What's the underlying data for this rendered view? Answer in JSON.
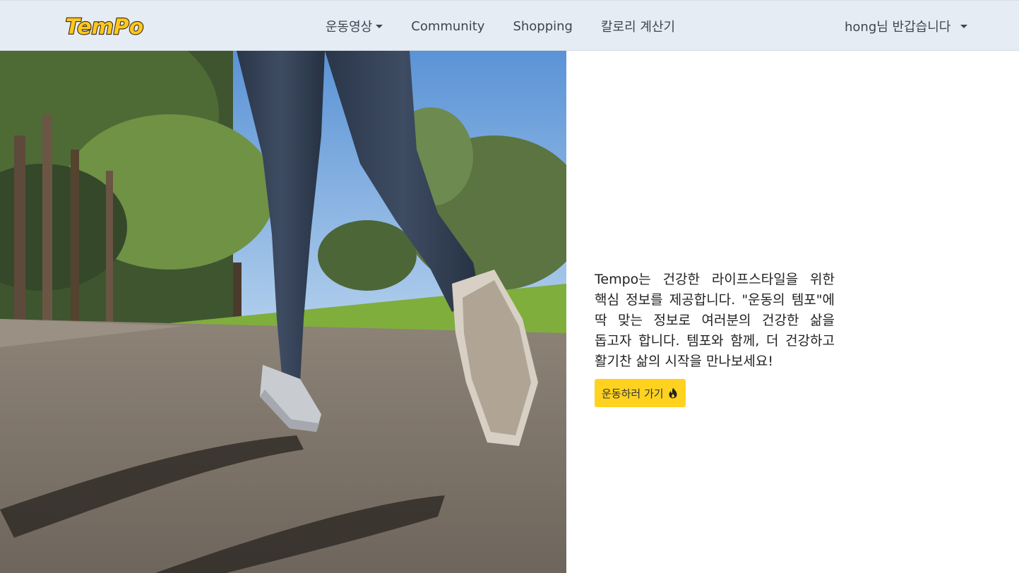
{
  "brand": {
    "logo_text": "TemPo"
  },
  "nav": {
    "items": [
      {
        "label": "운동영상",
        "has_dropdown": true
      },
      {
        "label": "Community",
        "has_dropdown": false
      },
      {
        "label": "Shopping",
        "has_dropdown": false
      },
      {
        "label": "칼로리 계산기",
        "has_dropdown": false
      }
    ],
    "user_greeting": "hong님 반갑습니다"
  },
  "hero": {
    "description": "Tempo는 건강한 라이프스타일을 위한 핵심 정보를 제공합니다. \"운동의 템포\"에 딱 맞는 정보로 여러분의 건강한 삶을 돕고자 합니다. 템포와 함께, 더 건강하고 활기찬 삶의 시작을 만나보세요!",
    "cta_label": "운동하러 가기"
  },
  "colors": {
    "navbar_bg": "#e6ecf3",
    "accent_yellow": "#ffd21f",
    "logo_fill": "#ffc81e"
  },
  "icons": [
    "chevron-down-icon",
    "fire-icon"
  ]
}
